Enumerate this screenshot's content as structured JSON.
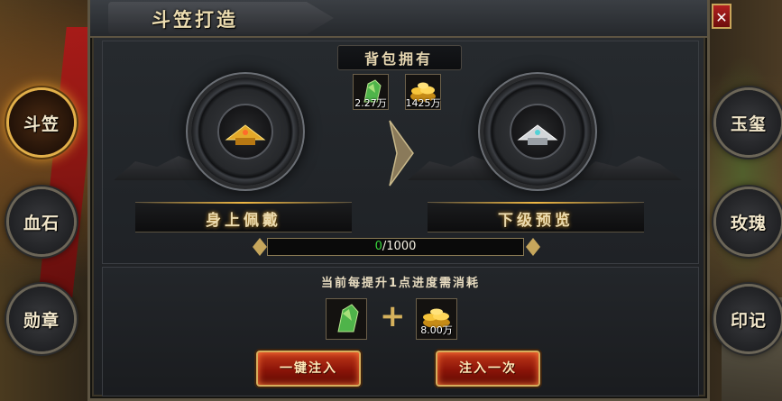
{
  "window": {
    "title": "斗笠打造",
    "close_label": "✕"
  },
  "owned": {
    "label": "背包拥有",
    "items": [
      {
        "icon": "green-jade-icon",
        "value": "2.27万"
      },
      {
        "icon": "gold-ingots-icon",
        "value": "1425万"
      }
    ]
  },
  "current": {
    "caption": "身上佩戴",
    "icon": "gold-hat-icon"
  },
  "next": {
    "caption": "下级预览",
    "icon": "silver-hat-icon"
  },
  "progress": {
    "current": "0",
    "max": "/1000",
    "fraction": 0
  },
  "cost": {
    "label": "当前每提升1点进度需消耗",
    "items": [
      {
        "icon": "green-jade-icon",
        "value": ""
      },
      {
        "icon": "gold-ingots-icon",
        "value": "8.00万"
      }
    ],
    "plus": "+"
  },
  "buttons": {
    "inject_all": "一键注入",
    "inject_once": "注入一次"
  },
  "left_tabs": [
    {
      "label": "斗笠",
      "active": true
    },
    {
      "label": "血石",
      "active": false
    },
    {
      "label": "勋章",
      "active": false
    }
  ],
  "right_tabs": [
    {
      "label": "玉玺"
    },
    {
      "label": "玫瑰"
    },
    {
      "label": "印记"
    }
  ],
  "colors": {
    "accent": "#d7ad5c",
    "progress": "#37d63b",
    "button": "#8b1408"
  }
}
